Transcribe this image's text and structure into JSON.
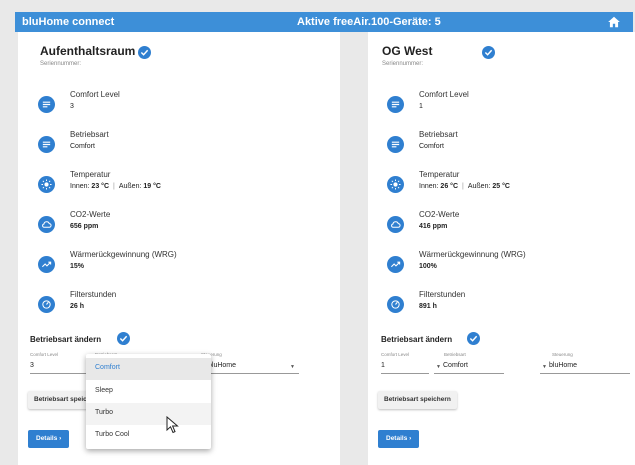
{
  "header": {
    "app_title": "bluHome connect",
    "center_title": "Aktive freeAir.100-Geräte: 5",
    "home_icon": "home-icon"
  },
  "colors": {
    "accent": "#2f7fd0",
    "header_bg": "#3d8fd8",
    "page_bg": "#e9e9e9"
  },
  "devices": [
    {
      "name": "Aufenthaltsraum",
      "serial_label": "Seriennummer:",
      "metrics": {
        "comfort": {
          "label": "Comfort Level",
          "value": "3"
        },
        "mode": {
          "label": "Betriebsart",
          "value": "Comfort"
        },
        "temperature": {
          "label": "Temperatur",
          "inside_label": "Innen:",
          "inside_value": "23 °C",
          "separator": "|",
          "outside_label": "Außen:",
          "outside_value": "19 °C"
        },
        "co2": {
          "label": "CO2-Werte",
          "value": "656 ppm"
        },
        "wrg": {
          "label": "Wärmerückgewinnung (WRG)",
          "value": "15%"
        },
        "filter": {
          "label": "Filterstunden",
          "value": "26 h"
        }
      },
      "change_section": {
        "title": "Betriebsart ändern",
        "comfort_label": "Comfort Level",
        "comfort_value": "3",
        "mode_label": "Betriebsart",
        "control_label": "Steuerung",
        "control_value": "bluHome",
        "save_button": "Betriebsart speichern",
        "details_button": "Details"
      }
    },
    {
      "name": "OG West",
      "serial_label": "Seriennummer:",
      "metrics": {
        "comfort": {
          "label": "Comfort Level",
          "value": "1"
        },
        "mode": {
          "label": "Betriebsart",
          "value": "Comfort"
        },
        "temperature": {
          "label": "Temperatur",
          "inside_label": "Innen:",
          "inside_value": "26 °C",
          "separator": "|",
          "outside_label": "Außen:",
          "outside_value": "25 °C"
        },
        "co2": {
          "label": "CO2-Werte",
          "value": "416 ppm"
        },
        "wrg": {
          "label": "Wärmerückgewinnung (WRG)",
          "value": "100%"
        },
        "filter": {
          "label": "Filterstunden",
          "value": "891 h"
        }
      },
      "change_section": {
        "title": "Betriebsart ändern",
        "comfort_label": "Comfort Level",
        "comfort_value": "1",
        "mode_label": "Betriebsart",
        "mode_value": "Comfort",
        "control_label": "Steuerung",
        "control_value": "bluHome",
        "save_button": "Betriebsart speichern",
        "details_button": "Details"
      }
    }
  ],
  "dropdown": {
    "options": [
      "Comfort",
      "Sleep",
      "Turbo",
      "Turbo Cool"
    ],
    "selected": "Comfort",
    "hovered": "Turbo"
  }
}
